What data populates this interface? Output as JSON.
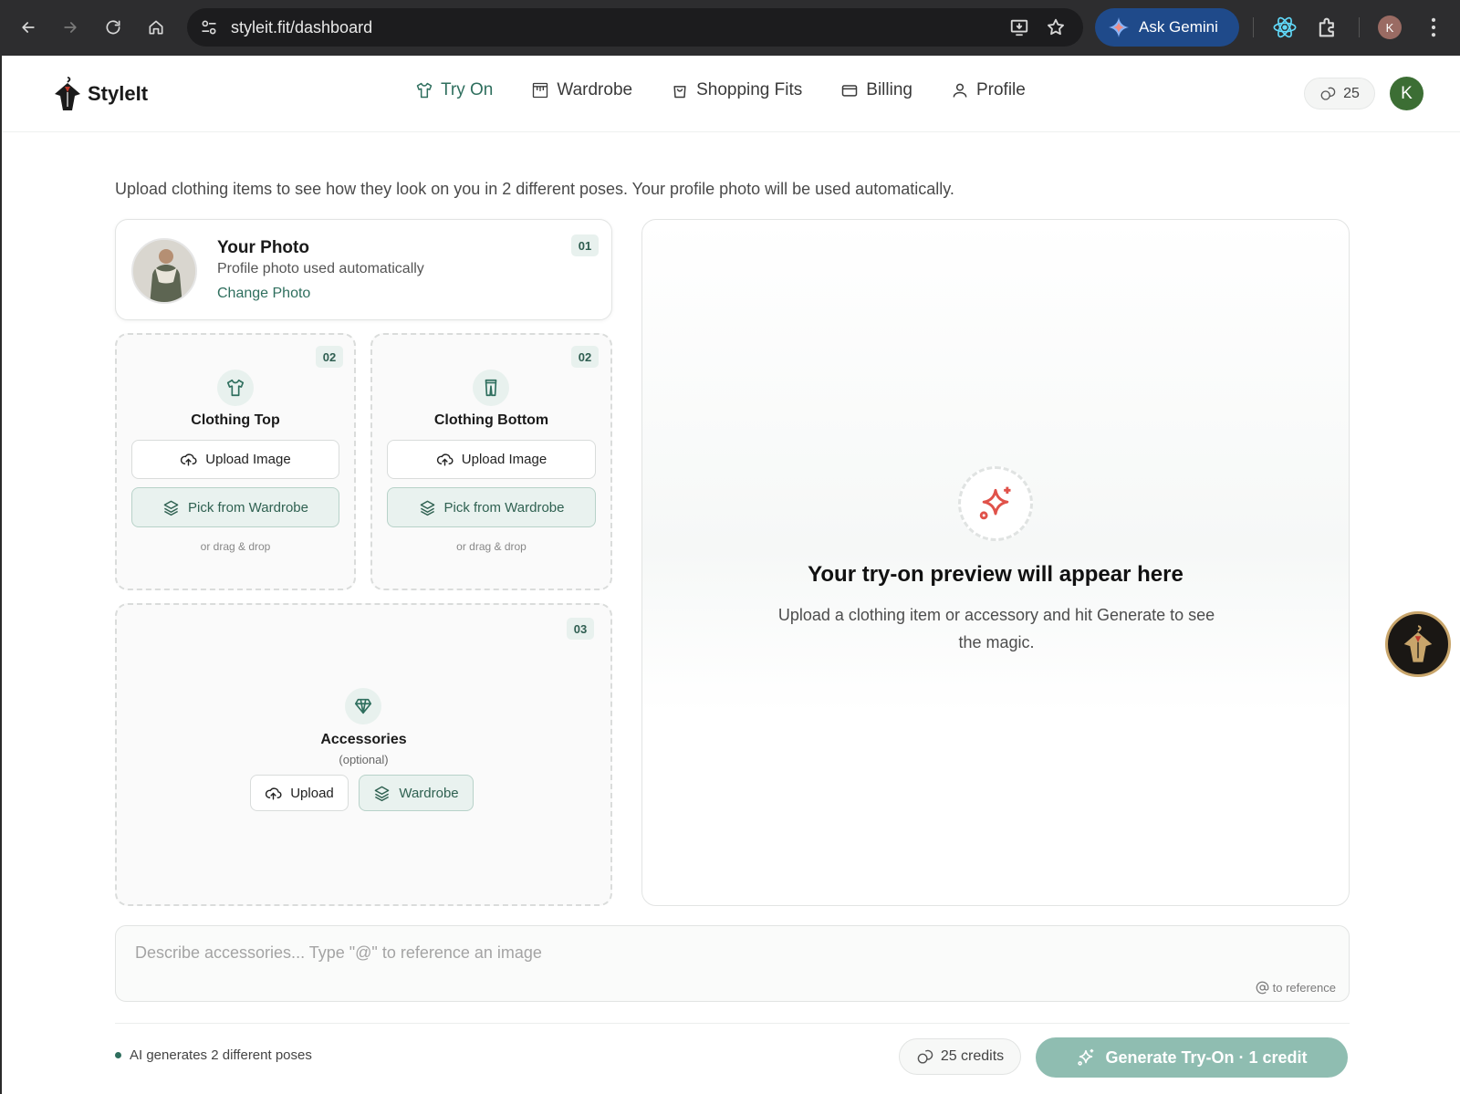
{
  "browser": {
    "url": "styleit.fit/dashboard",
    "gemini_label": "Ask Gemini",
    "profile_initial": "K"
  },
  "header": {
    "brand": "StyleIt",
    "nav": [
      {
        "label": "Try On",
        "icon": "shirt-icon",
        "active": true
      },
      {
        "label": "Wardrobe",
        "icon": "wardrobe-icon",
        "active": false
      },
      {
        "label": "Shopping Fits",
        "icon": "shopping-bag-icon",
        "active": false
      },
      {
        "label": "Billing",
        "icon": "credit-card-icon",
        "active": false
      },
      {
        "label": "Profile",
        "icon": "user-icon",
        "active": false
      }
    ],
    "credits": "25",
    "avatar_initial": "K"
  },
  "intro": "Upload clothing items to see how they look on you in 2 different poses. Your profile photo will be used automatically.",
  "photo_card": {
    "title": "Your Photo",
    "subtitle": "Profile photo used automatically",
    "link": "Change Photo",
    "step": "01"
  },
  "top_card": {
    "title": "Clothing Top",
    "step": "02",
    "upload": "Upload Image",
    "wardrobe": "Pick from Wardrobe",
    "hint": "or drag & drop"
  },
  "bottom_card": {
    "title": "Clothing Bottom",
    "step": "02",
    "upload": "Upload Image",
    "wardrobe": "Pick from Wardrobe",
    "hint": "or drag & drop"
  },
  "accessories_card": {
    "title": "Accessories",
    "optional": "(optional)",
    "step": "03",
    "upload": "Upload",
    "wardrobe": "Wardrobe"
  },
  "preview": {
    "title": "Your try-on preview will appear here",
    "subtitle": "Upload a clothing item or accessory and hit Generate to see the magic."
  },
  "prompt": {
    "placeholder": "Describe accessories... Type \"@\" to reference an image",
    "hint": "to reference"
  },
  "footer": {
    "note": "AI generates 2 different poses",
    "credits": "25 credits",
    "generate": "Generate Try-On · 1 credit"
  },
  "colors": {
    "accent": "#2f6f5e",
    "accent_light": "#e9f2ef",
    "generate_button": "#8fbdb1",
    "avatar": "#3c6e34",
    "sparkle": "#e0524a"
  }
}
